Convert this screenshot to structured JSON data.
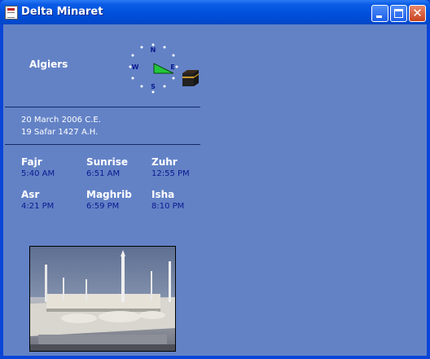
{
  "window": {
    "title": "Delta Minaret",
    "close_glyph": "✕"
  },
  "location": {
    "city": "Algiers"
  },
  "compass": {
    "north": "N",
    "south": "S",
    "east": "E",
    "west": "W",
    "qibla_arrow_color": "#22c63a"
  },
  "dates": {
    "gregorian": "20 March 2006 C.E.",
    "hijri": "19 Safar 1427 A.H."
  },
  "prayers": [
    {
      "name": "Fajr",
      "time": "5:40 AM"
    },
    {
      "name": "Sunrise",
      "time": "6:51 AM"
    },
    {
      "name": "Zuhr",
      "time": "12:55 PM"
    },
    {
      "name": "Asr",
      "time": "4:21 PM"
    },
    {
      "name": "Maghrib",
      "time": "6:59 PM"
    },
    {
      "name": "Isha",
      "time": "8:10 PM"
    }
  ],
  "colors": {
    "window_frame": "#0a45d8",
    "client_background": "#6382c6",
    "time_text": "#0b1a8f"
  }
}
